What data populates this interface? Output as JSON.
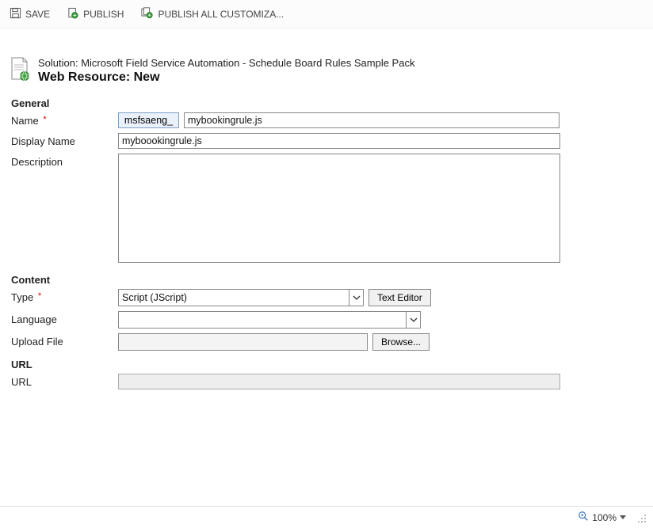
{
  "toolbar": {
    "save": "SAVE",
    "publish": "PUBLISH",
    "publish_all": "PUBLISH ALL CUSTOMIZA..."
  },
  "header": {
    "solution_line": "Solution: Microsoft Field Service Automation - Schedule Board Rules Sample Pack",
    "entity_line": "Web Resource: New"
  },
  "sections": {
    "general": "General",
    "content": "Content",
    "url": "URL"
  },
  "labels": {
    "name": "Name",
    "display_name": "Display Name",
    "description": "Description",
    "type": "Type",
    "language": "Language",
    "upload_file": "Upload File",
    "url": "URL"
  },
  "required_mark": "*",
  "values": {
    "name_prefix": "msfsaeng_",
    "name": "mybookingrule.js",
    "display_name": "myboookingrule.js",
    "description": "",
    "type_selected": "Script (JScript)",
    "language_selected": "",
    "upload_file_path": "",
    "url": ""
  },
  "buttons": {
    "text_editor": "Text Editor",
    "browse": "Browse..."
  },
  "status": {
    "zoom": "100%"
  }
}
